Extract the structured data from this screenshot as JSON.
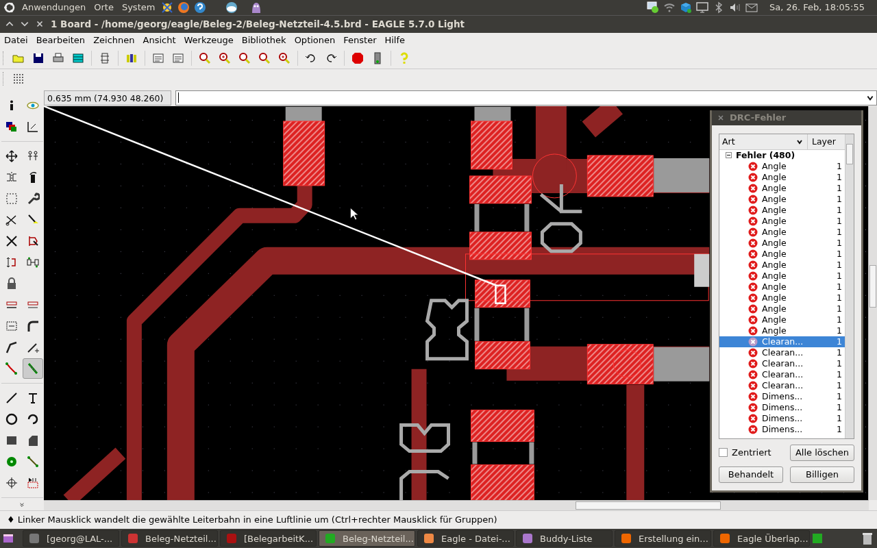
{
  "top_panel": {
    "menus": [
      "Anwendungen",
      "Orte",
      "System"
    ],
    "clock": "Sa, 26. Feb, 18:05:55"
  },
  "window": {
    "title": "1 Board - /home/georg/eagle/Beleg-2/Beleg-Netzteil-4.5.brd - EAGLE 5.7.0 Light"
  },
  "menu": [
    "Datei",
    "Bearbeiten",
    "Zeichnen",
    "Ansicht",
    "Werkzeuge",
    "Bibliothek",
    "Optionen",
    "Fenster",
    "Hilfe"
  ],
  "palette": [
    [
      {
        "selected": false
      },
      {
        "selected": false
      },
      {
        "selected": false
      },
      {
        "selected": false
      }
    ],
    [
      {
        "selected": false
      },
      {
        "selected": false
      },
      {
        "selected": false
      },
      {
        "selected": false
      },
      {
        "selected": false
      },
      {
        "selected": false
      },
      {
        "selected": false
      },
      {
        "selected": false
      },
      {
        "selected": false
      },
      {
        "selected": false
      },
      {
        "selected": false
      },
      {
        "selected": false
      },
      {
        "selected": false
      },
      {
        "selected": false
      },
      {
        "selected": false
      },
      {
        "selected": false
      },
      {
        "selected": false
      },
      {
        "selected": false
      },
      {
        "selected": false
      },
      {
        "selected": false
      },
      {
        "selected": true
      }
    ],
    [
      {
        "selected": false
      },
      {
        "selected": false
      },
      {
        "selected": false
      },
      {
        "selected": false
      },
      {
        "selected": false
      },
      {
        "selected": false
      },
      {
        "selected": false
      },
      {
        "selected": false
      },
      {
        "selected": false
      },
      {
        "selected": false
      }
    ]
  ],
  "coordinates": "0.635 mm (74.930 48.260)",
  "drc_dialog": {
    "title": "DRC-Fehler",
    "columns": [
      "Art",
      "Layer"
    ],
    "group": {
      "label": "Fehler (480)",
      "expanded": true,
      "children": [
        {
          "art": "Angle",
          "layer": "1",
          "selected": false
        },
        {
          "art": "Angle",
          "layer": "1",
          "selected": false
        },
        {
          "art": "Angle",
          "layer": "1",
          "selected": false
        },
        {
          "art": "Angle",
          "layer": "1",
          "selected": false
        },
        {
          "art": "Angle",
          "layer": "1",
          "selected": false
        },
        {
          "art": "Angle",
          "layer": "1",
          "selected": false
        },
        {
          "art": "Angle",
          "layer": "1",
          "selected": false
        },
        {
          "art": "Angle",
          "layer": "1",
          "selected": false
        },
        {
          "art": "Angle",
          "layer": "1",
          "selected": false
        },
        {
          "art": "Angle",
          "layer": "1",
          "selected": false
        },
        {
          "art": "Angle",
          "layer": "1",
          "selected": false
        },
        {
          "art": "Angle",
          "layer": "1",
          "selected": false
        },
        {
          "art": "Angle",
          "layer": "1",
          "selected": false
        },
        {
          "art": "Angle",
          "layer": "1",
          "selected": false
        },
        {
          "art": "Angle",
          "layer": "1",
          "selected": false
        },
        {
          "art": "Angle",
          "layer": "1",
          "selected": false
        },
        {
          "art": "Clearan...",
          "layer": "1",
          "selected": true
        },
        {
          "art": "Clearan...",
          "layer": "1",
          "selected": false
        },
        {
          "art": "Clearan...",
          "layer": "1",
          "selected": false
        },
        {
          "art": "Clearan...",
          "layer": "1",
          "selected": false
        },
        {
          "art": "Clearan...",
          "layer": "1",
          "selected": false
        },
        {
          "art": "Dimens...",
          "layer": "1",
          "selected": false
        },
        {
          "art": "Dimens...",
          "layer": "1",
          "selected": false
        },
        {
          "art": "Dimens...",
          "layer": "1",
          "selected": false
        },
        {
          "art": "Dimens...",
          "layer": "1",
          "selected": false
        }
      ]
    },
    "centered": {
      "label": "Zentriert",
      "checked": false
    },
    "buttons": [
      "Alle löschen",
      "Behandelt",
      "Billigen"
    ]
  },
  "status_bar": "♦ Linker Mausklick wandelt die gewählte Leiterbahn in eine Luftlinie um (Ctrl+rechter Mausklick für Gruppen)",
  "taskbar": [
    {
      "label": "[georg@LAL-...",
      "selected": false
    },
    {
      "label": "Beleg-Netzteil...",
      "selected": false
    },
    {
      "label": "[BelegarbeitK...",
      "selected": false
    },
    {
      "label": "Beleg-Netzteil...",
      "selected": true
    },
    {
      "label": "Eagle - Datei-...",
      "selected": false
    },
    {
      "label": "Buddy-Liste",
      "selected": false
    },
    {
      "label": "Erstellung ein...",
      "selected": false
    },
    {
      "label": "Eagle Überlap...",
      "selected": false
    }
  ]
}
